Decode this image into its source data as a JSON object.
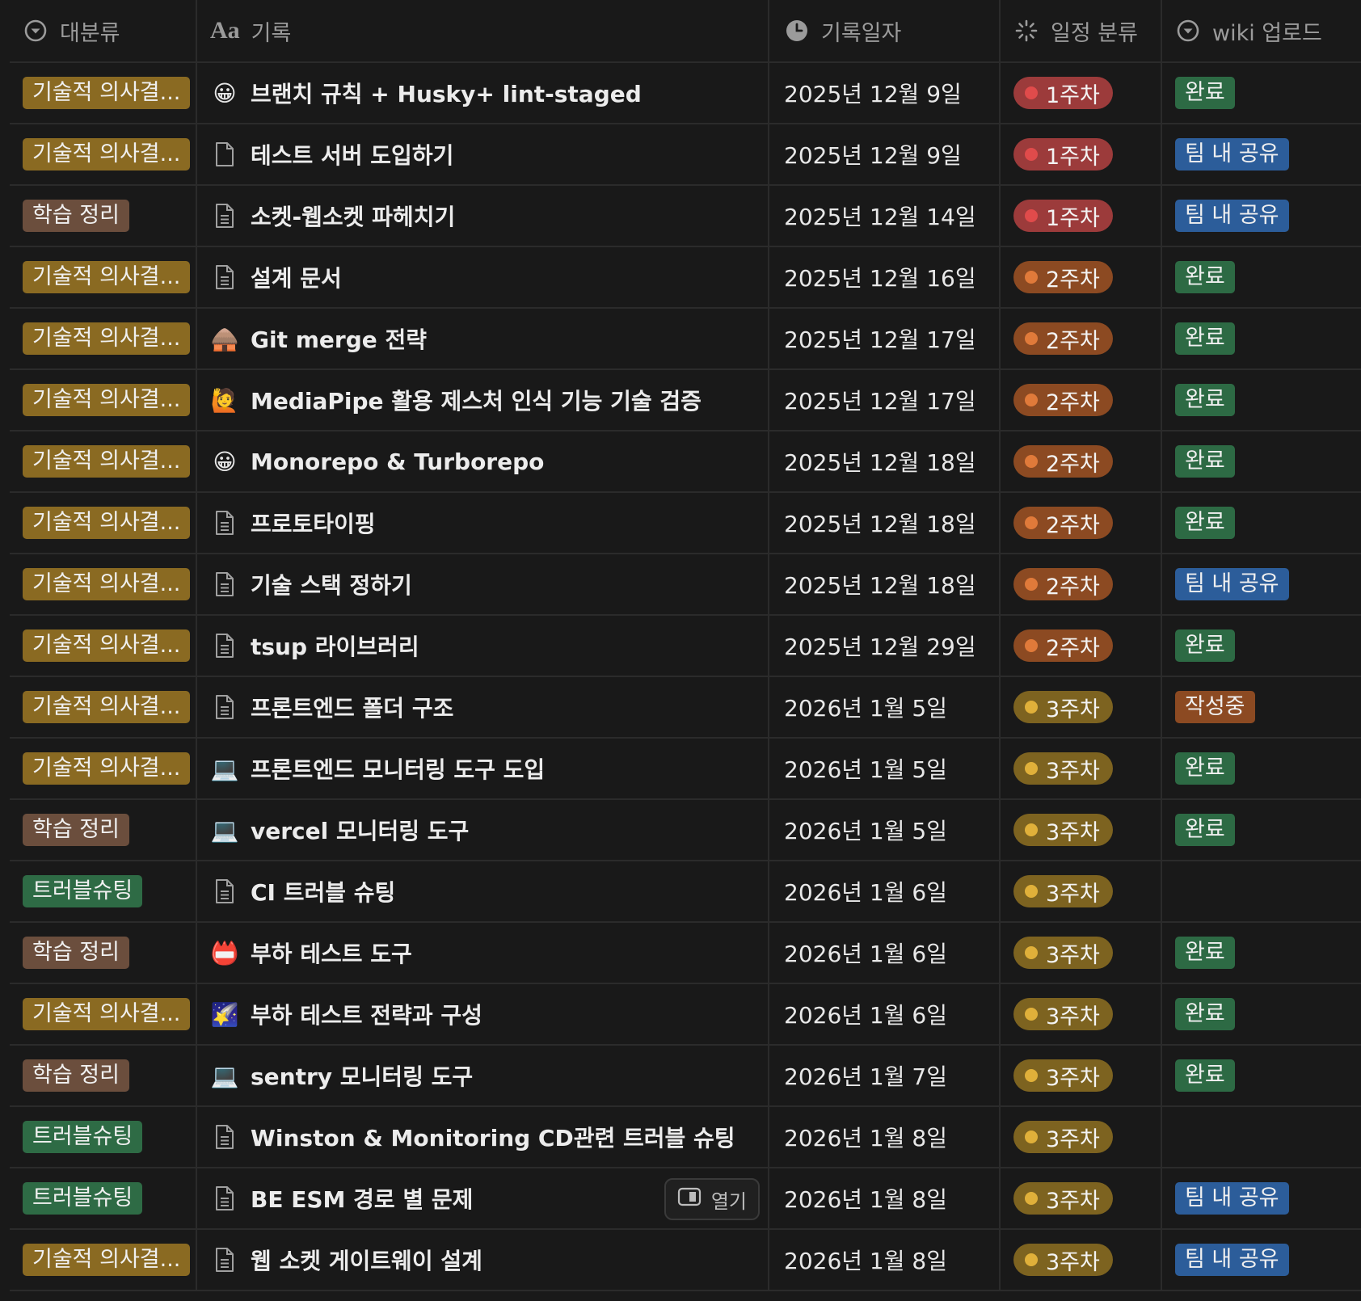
{
  "headers": {
    "category": "대분류",
    "title_prefix": "Aa",
    "title": "기록",
    "date": "기록일자",
    "schedule": "일정 분류",
    "wiki": "wiki 업로드"
  },
  "open_button": "열기",
  "colors": {
    "tag_tech": "#8a6a22",
    "tag_study": "#6b4e3d",
    "tag_trouble": "#2e6b45",
    "week1_bg": "#9c3b3b",
    "week1_dot": "#e04b4b",
    "week2_bg": "#8c4a22",
    "week2_dot": "#e07a3a",
    "week3_bg": "#7d6320",
    "week3_dot": "#e0b03a",
    "wiki_done": "#2d6a44",
    "wiki_shared": "#2c5d9a",
    "wiki_writing": "#8c4a22"
  },
  "rows": [
    {
      "category": "기술적 의사결...",
      "ctype": "tech",
      "icon": "😀",
      "icon_name": "grinning-face-icon",
      "title": "브랜치 규칙 + Husky+ lint-staged",
      "date": "2025년 12월 9일",
      "week": "1주차",
      "wtype": "1",
      "wiki": "완료",
      "wikitype": "done"
    },
    {
      "category": "기술적 의사결...",
      "ctype": "tech",
      "icon": "page",
      "icon_name": "page-icon",
      "title": "테스트 서버 도입하기",
      "date": "2025년 12월 9일",
      "week": "1주차",
      "wtype": "1",
      "wiki": "팀 내 공유",
      "wikitype": "shared"
    },
    {
      "category": "학습 정리",
      "ctype": "study",
      "icon": "doc",
      "icon_name": "document-icon",
      "title": "소켓-웹소켓 파헤치기",
      "date": "2025년 12월 14일",
      "week": "1주차",
      "wtype": "1",
      "wiki": "팀 내 공유",
      "wikitype": "shared"
    },
    {
      "category": "기술적 의사결...",
      "ctype": "tech",
      "icon": "doc",
      "icon_name": "document-icon",
      "title": "설계 문서",
      "date": "2025년 12월 16일",
      "week": "2주차",
      "wtype": "2",
      "wiki": "완료",
      "wikitype": "done"
    },
    {
      "category": "기술적 의사결...",
      "ctype": "tech",
      "icon": "🛖",
      "icon_name": "hut-icon",
      "title": "Git merge 전략",
      "date": "2025년 12월 17일",
      "week": "2주차",
      "wtype": "2",
      "wiki": "완료",
      "wikitype": "done"
    },
    {
      "category": "기술적 의사결...",
      "ctype": "tech",
      "icon": "🙋",
      "icon_name": "person-raising-hand-icon",
      "title": "MediaPipe 활용 제스처 인식 기능 기술 검증",
      "date": "2025년 12월 17일",
      "week": "2주차",
      "wtype": "2",
      "wiki": "완료",
      "wikitype": "done"
    },
    {
      "category": "기술적 의사결...",
      "ctype": "tech",
      "icon": "😀",
      "icon_name": "grinning-face-icon",
      "title": "Monorepo  & Turborepo",
      "date": "2025년 12월 18일",
      "week": "2주차",
      "wtype": "2",
      "wiki": "완료",
      "wikitype": "done"
    },
    {
      "category": "기술적 의사결...",
      "ctype": "tech",
      "icon": "doc",
      "icon_name": "document-icon",
      "title": "프로토타이핑",
      "date": "2025년 12월 18일",
      "week": "2주차",
      "wtype": "2",
      "wiki": "완료",
      "wikitype": "done"
    },
    {
      "category": "기술적 의사결...",
      "ctype": "tech",
      "icon": "doc",
      "icon_name": "document-icon",
      "title": "기술 스택 정하기",
      "date": "2025년 12월 18일",
      "week": "2주차",
      "wtype": "2",
      "wiki": "팀 내 공유",
      "wikitype": "shared"
    },
    {
      "category": "기술적 의사결...",
      "ctype": "tech",
      "icon": "doc",
      "icon_name": "document-icon",
      "title": "tsup 라이브러리",
      "date": "2025년 12월 29일",
      "week": "2주차",
      "wtype": "2",
      "wiki": "완료",
      "wikitype": "done"
    },
    {
      "category": "기술적 의사결...",
      "ctype": "tech",
      "icon": "doc",
      "icon_name": "document-icon",
      "title": "프론트엔드 폴더 구조",
      "date": "2026년 1월 5일",
      "week": "3주차",
      "wtype": "3",
      "wiki": "작성중",
      "wikitype": "writing"
    },
    {
      "category": "기술적 의사결...",
      "ctype": "tech",
      "icon": "💻",
      "icon_name": "laptop-icon",
      "title": "프론트엔드 모니터링 도구 도입",
      "date": "2026년 1월 5일",
      "week": "3주차",
      "wtype": "3",
      "wiki": "완료",
      "wikitype": "done"
    },
    {
      "category": "학습 정리",
      "ctype": "study",
      "icon": "💻",
      "icon_name": "laptop-icon",
      "title": "vercel 모니터링 도구",
      "date": "2026년 1월 5일",
      "week": "3주차",
      "wtype": "3",
      "wiki": "완료",
      "wikitype": "done"
    },
    {
      "category": "트러블슈팅",
      "ctype": "trouble",
      "icon": "doc",
      "icon_name": "document-icon",
      "title": "CI 트러블 슈팅",
      "date": "2026년 1월 6일",
      "week": "3주차",
      "wtype": "3",
      "wiki": "",
      "wikitype": "none"
    },
    {
      "category": "학습 정리",
      "ctype": "study",
      "icon": "📛",
      "icon_name": "name-badge-icon",
      "title": "부하 테스트 도구",
      "date": "2026년 1월 6일",
      "week": "3주차",
      "wtype": "3",
      "wiki": "완료",
      "wikitype": "done"
    },
    {
      "category": "기술적 의사결...",
      "ctype": "tech",
      "icon": "🌠",
      "icon_name": "shooting-star-icon",
      "title": "부하 테스트 전략과 구성",
      "date": "2026년 1월 6일",
      "week": "3주차",
      "wtype": "3",
      "wiki": "완료",
      "wikitype": "done"
    },
    {
      "category": "학습 정리",
      "ctype": "study",
      "icon": "💻",
      "icon_name": "laptop-icon",
      "title": "sentry 모니터링 도구",
      "date": "2026년 1월 7일",
      "week": "3주차",
      "wtype": "3",
      "wiki": "완료",
      "wikitype": "done"
    },
    {
      "category": "트러블슈팅",
      "ctype": "trouble",
      "icon": "doc",
      "icon_name": "document-icon",
      "title": "Winston & Monitoring CD관련 트러블 슈팅",
      "date": "2026년 1월 8일",
      "week": "3주차",
      "wtype": "3",
      "wiki": "",
      "wikitype": "none"
    },
    {
      "category": "트러블슈팅",
      "ctype": "trouble",
      "icon": "doc",
      "icon_name": "document-icon",
      "title": "BE ESM 경로 별 문제",
      "date": "2026년 1월 8일",
      "week": "3주차",
      "wtype": "3",
      "wiki": "팀 내 공유",
      "wikitype": "shared",
      "hover": true
    },
    {
      "category": "기술적 의사결...",
      "ctype": "tech",
      "icon": "doc",
      "icon_name": "document-icon",
      "title": "웹 소켓 게이트웨이 설계",
      "date": "2026년 1월 8일",
      "week": "3주차",
      "wtype": "3",
      "wiki": "팀 내 공유",
      "wikitype": "shared"
    }
  ]
}
